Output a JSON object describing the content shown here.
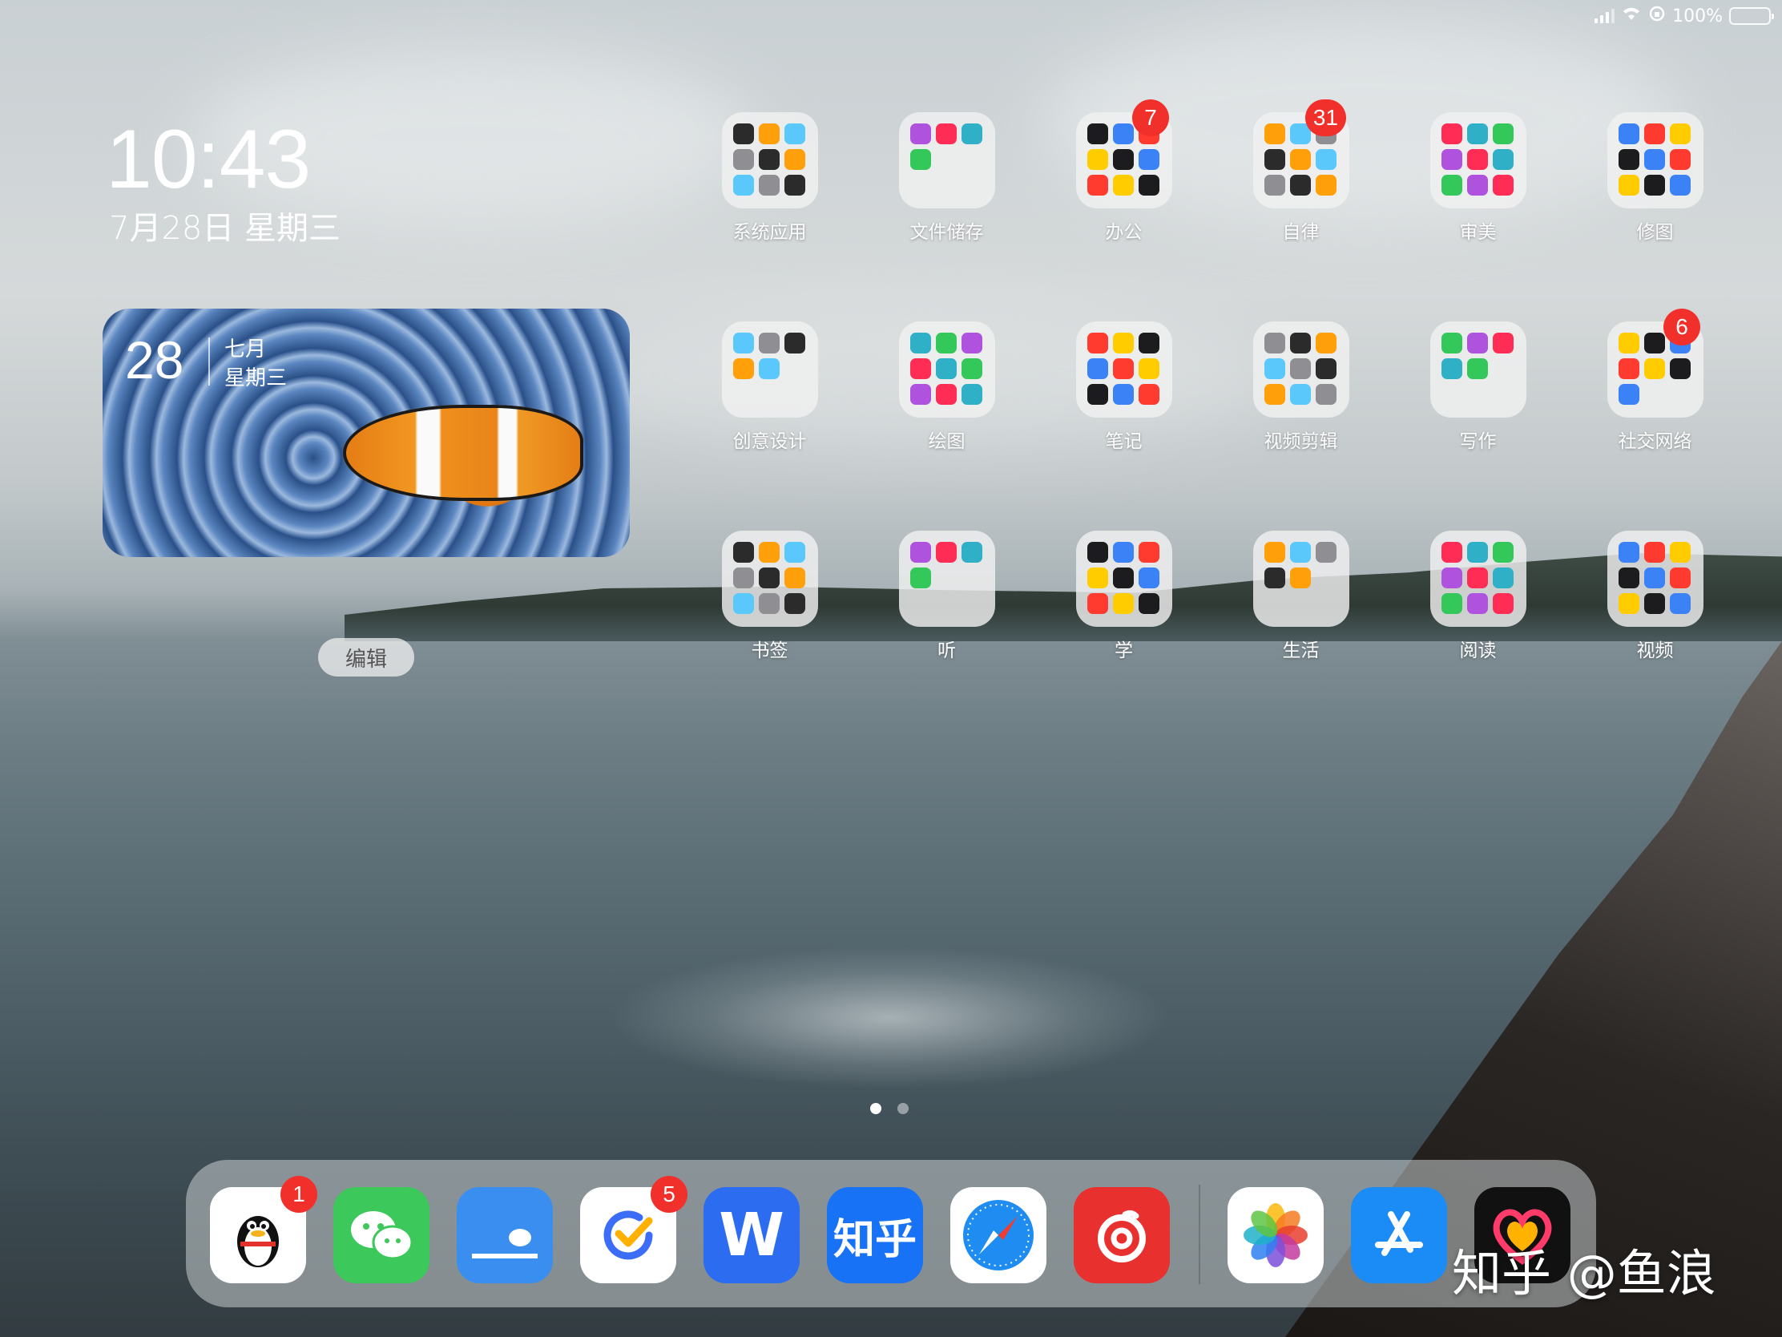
{
  "status_bar": {
    "battery_text": "100%",
    "battery_level": 1.0
  },
  "lock_clock": {
    "time": "10:43",
    "date": "7月28日 星期三"
  },
  "widget": {
    "day": "28",
    "month": "七月",
    "weekday": "星期三"
  },
  "edit_button": {
    "label": "编辑"
  },
  "folders": [
    {
      "label": "系统应用",
      "badge": ""
    },
    {
      "label": "文件储存",
      "badge": ""
    },
    {
      "label": "办公",
      "badge": "7"
    },
    {
      "label": "自律",
      "badge": "31"
    },
    {
      "label": "审美",
      "badge": ""
    },
    {
      "label": "修图",
      "badge": ""
    },
    {
      "label": "创意设计",
      "badge": ""
    },
    {
      "label": "绘图",
      "badge": ""
    },
    {
      "label": "笔记",
      "badge": ""
    },
    {
      "label": "视频剪辑",
      "badge": ""
    },
    {
      "label": "写作",
      "badge": ""
    },
    {
      "label": "社交网络",
      "badge": "6"
    },
    {
      "label": "书签",
      "badge": ""
    },
    {
      "label": "听",
      "badge": ""
    },
    {
      "label": "学",
      "badge": ""
    },
    {
      "label": "生活",
      "badge": ""
    },
    {
      "label": "阅读",
      "badge": ""
    },
    {
      "label": "视频",
      "badge": ""
    }
  ],
  "pages": {
    "count": 2,
    "current": 1
  },
  "dock": [
    {
      "name": "qq-icon",
      "text": "",
      "badge": "1",
      "color": "#ffffff"
    },
    {
      "name": "wechat-icon",
      "text": "",
      "badge": "",
      "color": "#3cc85a"
    },
    {
      "name": "chat-book-icon",
      "text": "",
      "badge": "",
      "color": "#3a8ef0"
    },
    {
      "name": "ticktick-icon",
      "text": "",
      "badge": "5",
      "color": "#ffffff"
    },
    {
      "name": "word-w-icon",
      "text": "W",
      "badge": "",
      "color": "#2c6cf0"
    },
    {
      "name": "zhihu-icon",
      "text": "知乎",
      "badge": "",
      "color": "#1772f6"
    },
    {
      "name": "safari-icon",
      "text": "",
      "badge": "",
      "color": "#ffffff"
    },
    {
      "name": "netease-music-icon",
      "text": "",
      "badge": "",
      "color": "#e8302e"
    },
    {
      "name": "photos-icon",
      "text": "",
      "badge": "",
      "color": "#ffffff"
    },
    {
      "name": "app-store-icon",
      "text": "",
      "badge": "",
      "color": "#1b8cf5"
    },
    {
      "name": "heart-app-icon",
      "text": "",
      "badge": "",
      "color": "#111111"
    }
  ],
  "watermark": "知乎 @鱼浪"
}
